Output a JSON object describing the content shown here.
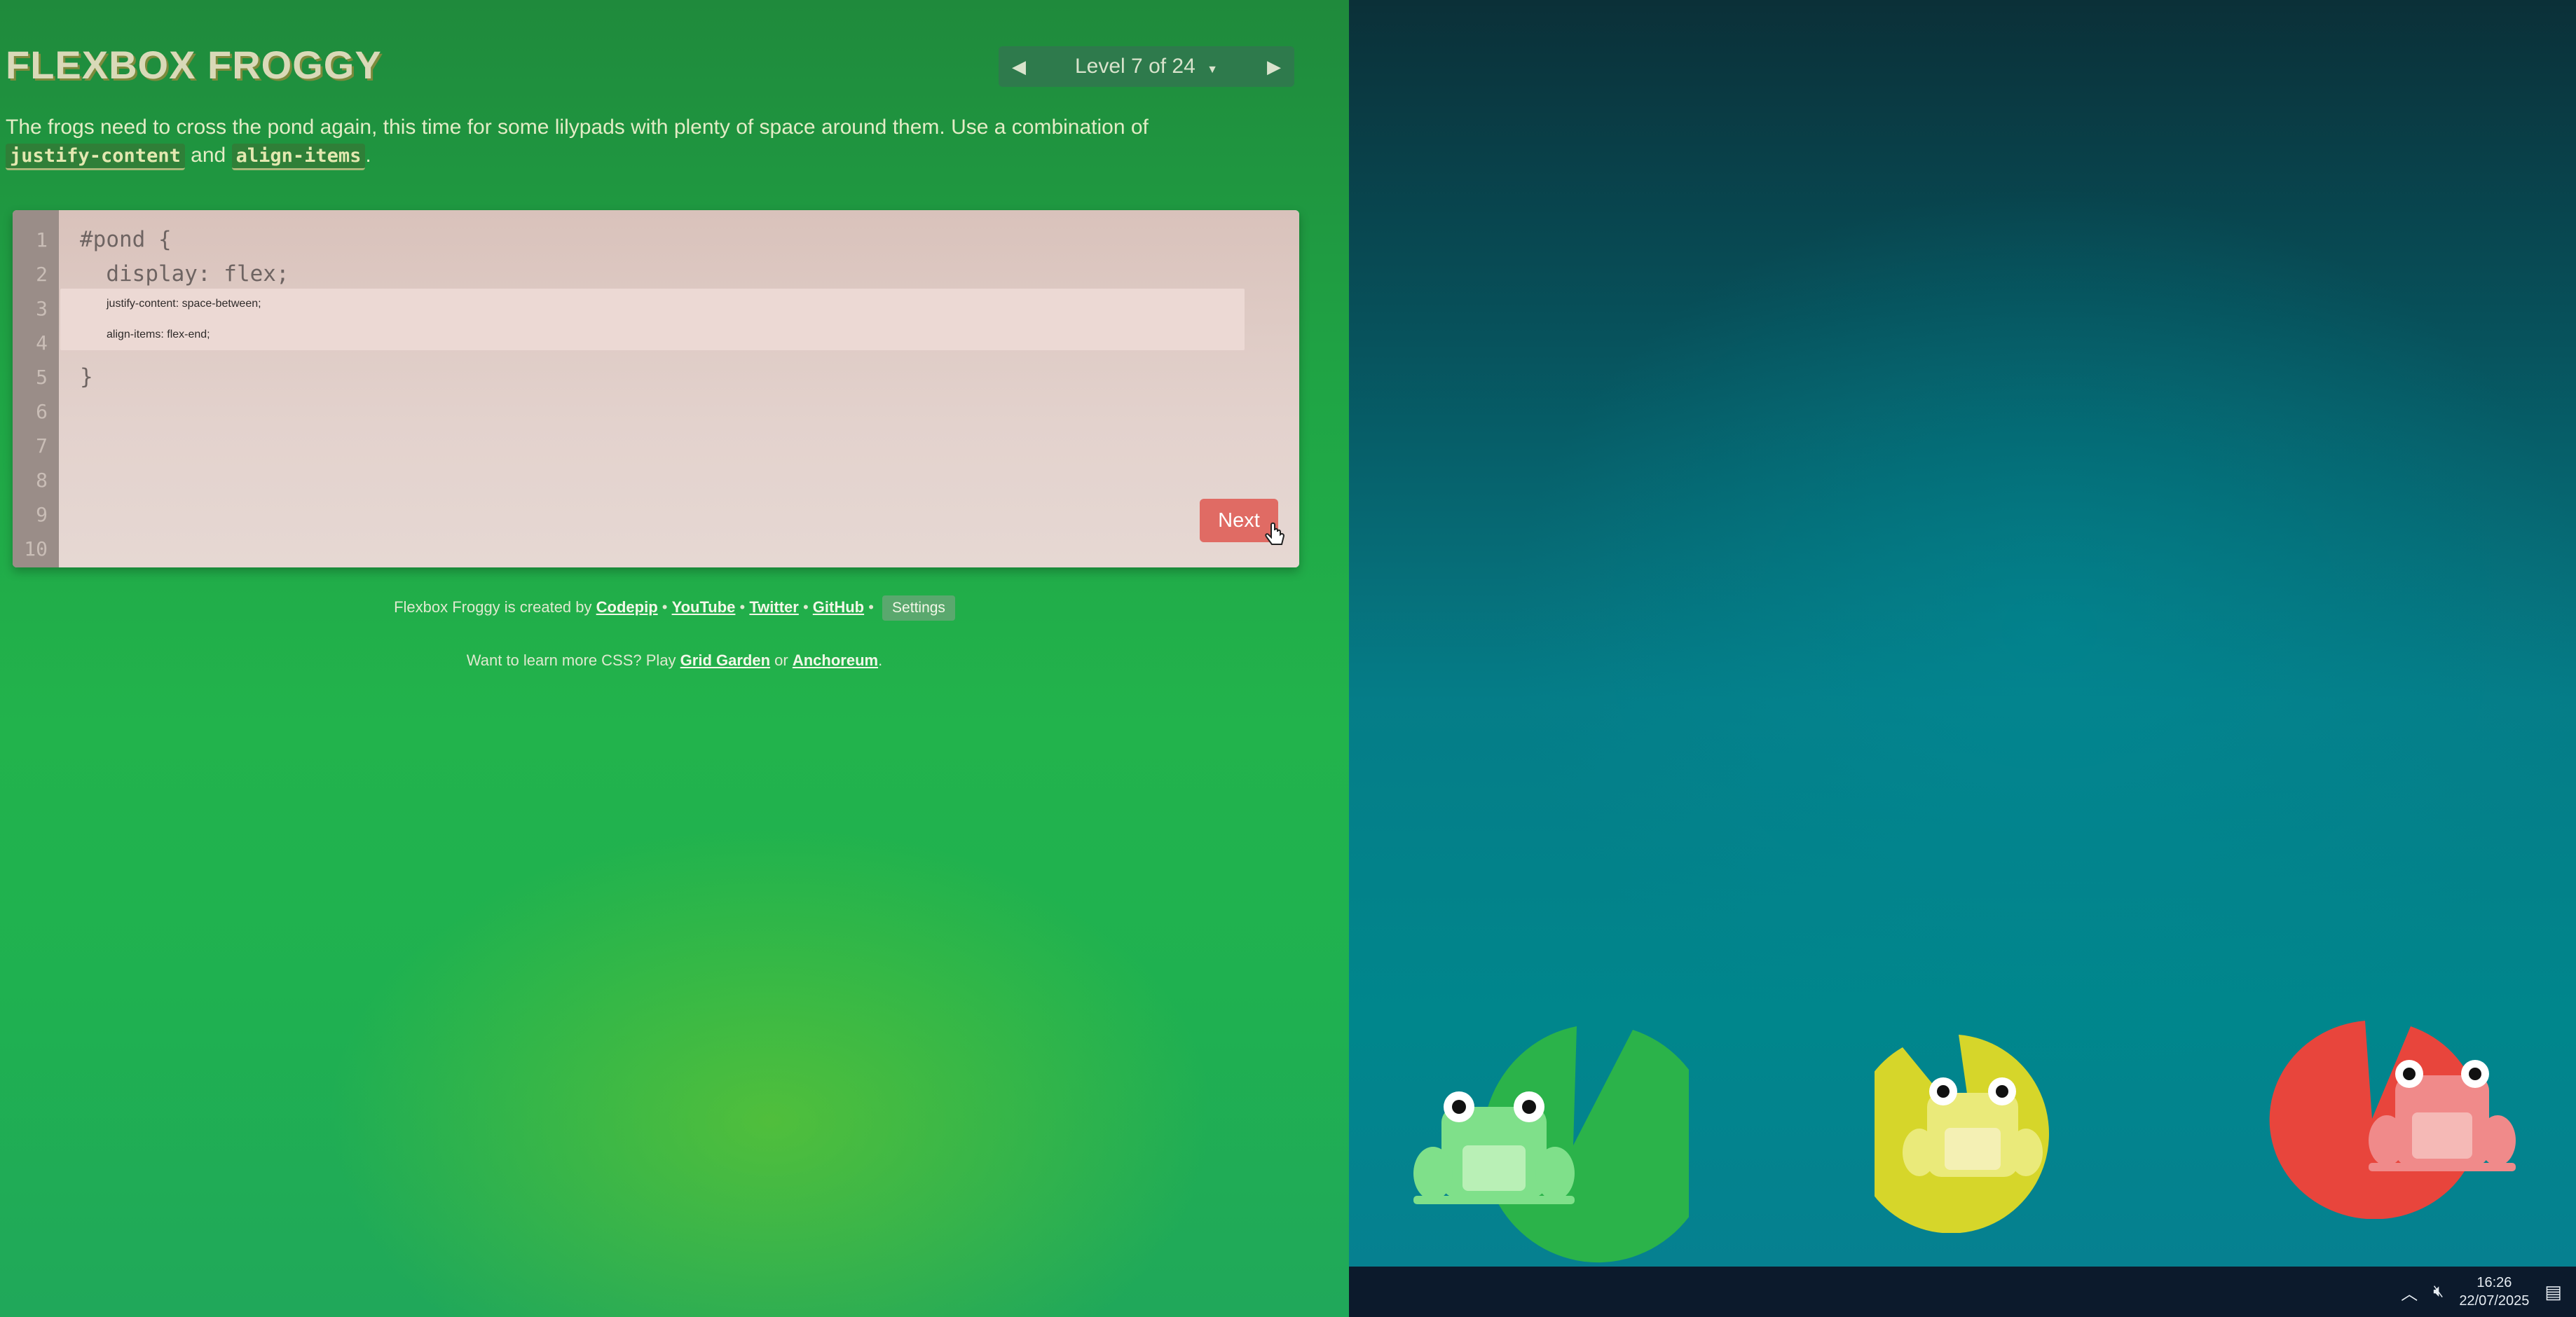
{
  "app": {
    "title": "FLEXBOX FROGGY"
  },
  "level_nav": {
    "prev_icon": "triangle-left-icon",
    "label": "Level 7 of 24",
    "dropdown_icon": "caret-down-icon",
    "next_icon": "triangle-right-icon"
  },
  "instructions": {
    "text_before": "The frogs need to cross the pond again, this time for some lilypads with plenty of space around them. Use a combination of ",
    "code1": "justify-content",
    "and": " and ",
    "code2": "align-items",
    "period": "."
  },
  "editor": {
    "line_numbers": [
      "1",
      "2",
      "3",
      "4",
      "5",
      "6",
      "7",
      "8",
      "9",
      "10"
    ],
    "line1": "#pond {",
    "line2": "  display: flex;",
    "input_line1": "justify-content: space-between;",
    "input_line2": "align-items: flex-end;",
    "line5": "}",
    "next_label": "Next"
  },
  "credits": {
    "prefix": "Flexbox Froggy is created by ",
    "codepip": "Codepip",
    "sep": " • ",
    "youtube": "YouTube",
    "twitter": "Twitter",
    "github": "GitHub",
    "settings": "Settings"
  },
  "learn_more": {
    "prefix": "Want to learn more CSS? Play ",
    "grid_garden": "Grid Garden",
    "or": " or ",
    "anchoreum": "Anchoreum",
    "period": "."
  },
  "pond": {
    "lilypads": [
      {
        "color": "green",
        "fill": "#2bb34a"
      },
      {
        "color": "yellow",
        "fill": "#d6d62a"
      },
      {
        "color": "red",
        "fill": "#e8453c"
      }
    ],
    "frogs": [
      {
        "color": "green",
        "fill": "#7fe08a"
      },
      {
        "color": "yellow",
        "fill": "#eaea7a"
      },
      {
        "color": "red",
        "fill": "#f08a8a"
      }
    ]
  },
  "taskbar": {
    "time": "16:26",
    "date": "22/07/2025",
    "tray_chevron_icon": "chevron-up-icon",
    "volume_icon": "volume-muted-icon",
    "notification_icon": "notification-icon"
  }
}
